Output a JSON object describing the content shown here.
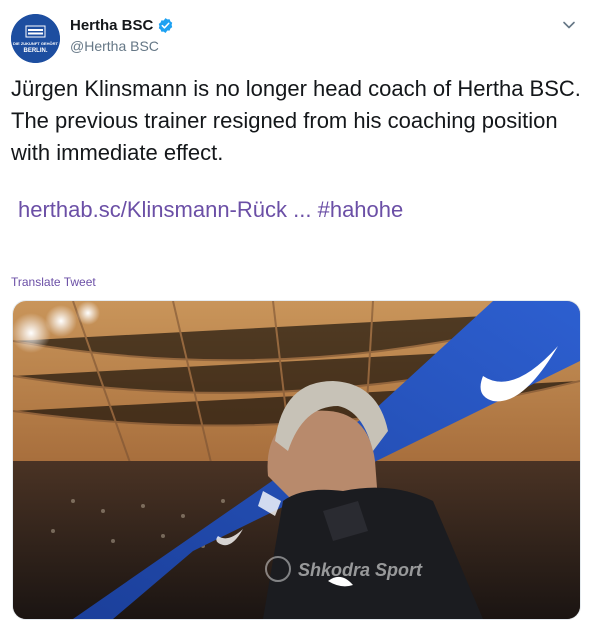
{
  "account": {
    "name": "Hertha BSC",
    "handle": "@Hertha BSC",
    "avatar_text": [
      "DIE ZUKUNFT GEHÖRT",
      "BERLIN."
    ]
  },
  "tweet": {
    "text": "Jürgen Klinsmann is no longer head coach of Hertha BSC. The previous trainer resigned from his coaching position with immediate effect.",
    "link": "herthab.sc/Klinsmann-Rück ...",
    "hashtag": "#hahohe",
    "translate_label": "Translate Tweet"
  },
  "media": {
    "watermark": "Shkodra Sport"
  },
  "icons": {
    "verified": "verified-badge-icon",
    "caret": "chevron-down-icon"
  },
  "colors": {
    "link": "#6b4fa6",
    "verified": "#1da1f2",
    "avatar_bg": "#1d4ea0"
  }
}
